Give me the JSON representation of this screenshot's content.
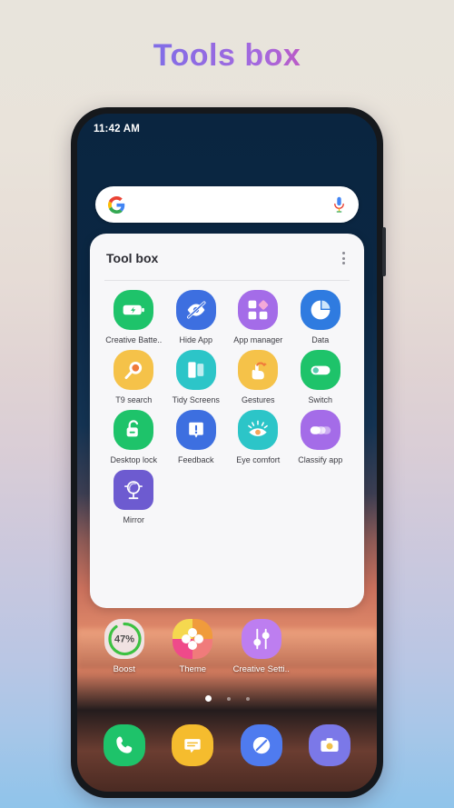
{
  "page": {
    "title": "Tools box",
    "title_gradient_from": "#5b7ef0",
    "title_gradient_to": "#f43f7f"
  },
  "phone": {
    "status_bar": {
      "time": "11:42 AM"
    },
    "search": {
      "google_icon": "google-g-icon",
      "mic_icon": "microphone-icon"
    }
  },
  "toolbox": {
    "title": "Tool box",
    "menu_icon": "kebab-menu-icon",
    "apps": [
      {
        "label": "Creative Batte..",
        "icon": "battery-charging-icon",
        "bg": "#1ec36a",
        "shape": "squircle"
      },
      {
        "label": "Hide App",
        "icon": "eye-slash-icon",
        "bg": "#3d6fe0",
        "shape": "squircle"
      },
      {
        "label": "App manager",
        "icon": "app-grid-icon",
        "bg": "#a46ce8",
        "shape": "squircle"
      },
      {
        "label": "Data",
        "icon": "pie-chart-icon",
        "bg": "#2f7be0",
        "shape": "squircle"
      },
      {
        "label": "T9 search",
        "icon": "magnifier-icon",
        "bg": "#f5c249",
        "shape": "squircle"
      },
      {
        "label": "Tidy Screens",
        "icon": "panels-icon",
        "bg": "#2cc5c8",
        "shape": "squircle"
      },
      {
        "label": "Gestures",
        "icon": "hand-swipe-icon",
        "bg": "#f5c249",
        "shape": "squircle"
      },
      {
        "label": "Switch",
        "icon": "toggle-switch-icon",
        "bg": "#1ec36a",
        "shape": "squircle"
      },
      {
        "label": "Desktop lock",
        "icon": "padlock-icon",
        "bg": "#1ec36a",
        "shape": "squircle"
      },
      {
        "label": "Feedback",
        "icon": "exclamation-bubble-icon",
        "bg": "#3d6fe0",
        "shape": "squircle"
      },
      {
        "label": "Eye comfort",
        "icon": "eye-icon",
        "bg": "#2cc5c8",
        "shape": "squircle"
      },
      {
        "label": "Classify app",
        "icon": "stacked-circles-icon",
        "bg": "#a46ce8",
        "shape": "squircle"
      },
      {
        "label": "Mirror",
        "icon": "mirror-icon",
        "bg": "#6d5bd0",
        "shape": "square"
      }
    ]
  },
  "homescreen": {
    "apps": [
      {
        "label": "Boost",
        "icon": "boost-gauge-icon",
        "value": "47%"
      },
      {
        "label": "Theme",
        "icon": "theme-flower-icon"
      },
      {
        "label": "Creative Setti..",
        "icon": "sliders-icon"
      }
    ],
    "page_dots": {
      "count": 3,
      "active_index": 0
    }
  },
  "dock": {
    "apps": [
      {
        "label": "Phone",
        "icon": "phone-icon",
        "bg": "#1ec36a"
      },
      {
        "label": "Messages",
        "icon": "message-icon",
        "bg": "#f5bc2e"
      },
      {
        "label": "Browser",
        "icon": "compass-icon",
        "bg": "#4f7bef"
      },
      {
        "label": "Camera",
        "icon": "camera-icon",
        "bg": "#7b78e8"
      }
    ]
  }
}
